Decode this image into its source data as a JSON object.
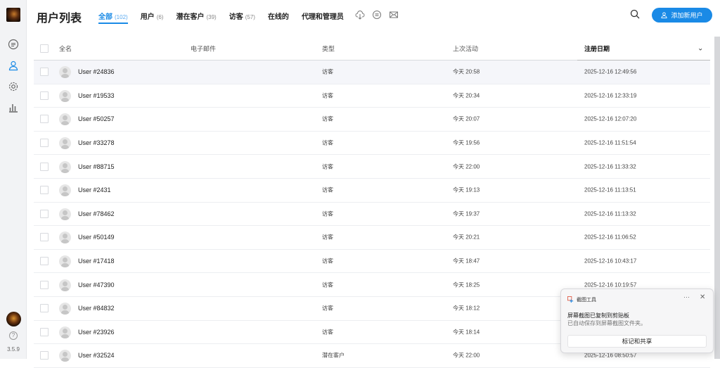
{
  "app": {
    "title": "用户列表",
    "version": "3.5.9"
  },
  "tabs": [
    {
      "label": "全部",
      "count": "(102)"
    },
    {
      "label": "用户",
      "count": "(6)"
    },
    {
      "label": "潜在客户",
      "count": "(39)"
    },
    {
      "label": "访客",
      "count": "(57)"
    },
    {
      "label": "在线的",
      "count": ""
    },
    {
      "label": "代理和管理员",
      "count": ""
    }
  ],
  "header": {
    "add_user_label": "添加新用户"
  },
  "table": {
    "columns": [
      "全名",
      "电子邮件",
      "类型",
      "上次活动",
      "注册日期"
    ],
    "rows": [
      {
        "name": "User #24836",
        "email": "",
        "type": "访客",
        "last": "今天 20:58",
        "reg": "2025-12-16 12:49:56"
      },
      {
        "name": "User #19533",
        "email": "",
        "type": "访客",
        "last": "今天 20:34",
        "reg": "2025-12-16 12:33:19"
      },
      {
        "name": "User #50257",
        "email": "",
        "type": "访客",
        "last": "今天 20:07",
        "reg": "2025-12-16 12:07:20"
      },
      {
        "name": "User #33278",
        "email": "",
        "type": "访客",
        "last": "今天 19:56",
        "reg": "2025-12-16 11:51:54"
      },
      {
        "name": "User #88715",
        "email": "",
        "type": "访客",
        "last": "今天 22:00",
        "reg": "2025-12-16 11:33:32"
      },
      {
        "name": "User #2431",
        "email": "",
        "type": "访客",
        "last": "今天 19:13",
        "reg": "2025-12-16 11:13:51"
      },
      {
        "name": "User #78462",
        "email": "",
        "type": "访客",
        "last": "今天 19:37",
        "reg": "2025-12-16 11:13:32"
      },
      {
        "name": "User #50149",
        "email": "",
        "type": "访客",
        "last": "今天 20:21",
        "reg": "2025-12-16 11:06:52"
      },
      {
        "name": "User #17418",
        "email": "",
        "type": "访客",
        "last": "今天 18:47",
        "reg": "2025-12-16 10:43:17"
      },
      {
        "name": "User #47390",
        "email": "",
        "type": "访客",
        "last": "今天 18:25",
        "reg": "2025-12-16 10:19:57"
      },
      {
        "name": "User #84832",
        "email": "",
        "type": "访客",
        "last": "今天 18:12",
        "reg": ""
      },
      {
        "name": "User #23926",
        "email": "",
        "type": "访客",
        "last": "今天 18:14",
        "reg": ""
      },
      {
        "name": "User #32524",
        "email": "",
        "type": "潜在客户",
        "last": "今天 22:00",
        "reg": "2025-12-16 08:50:57"
      }
    ]
  },
  "toast": {
    "app": "截图工具",
    "more": "···",
    "close": "✕",
    "message": "屏幕截图已复制到剪贴板",
    "detail": "已自动保存到屏幕截图文件夹。",
    "action": "标记和共享"
  },
  "colors": {
    "accent": "#1a8ae6"
  }
}
